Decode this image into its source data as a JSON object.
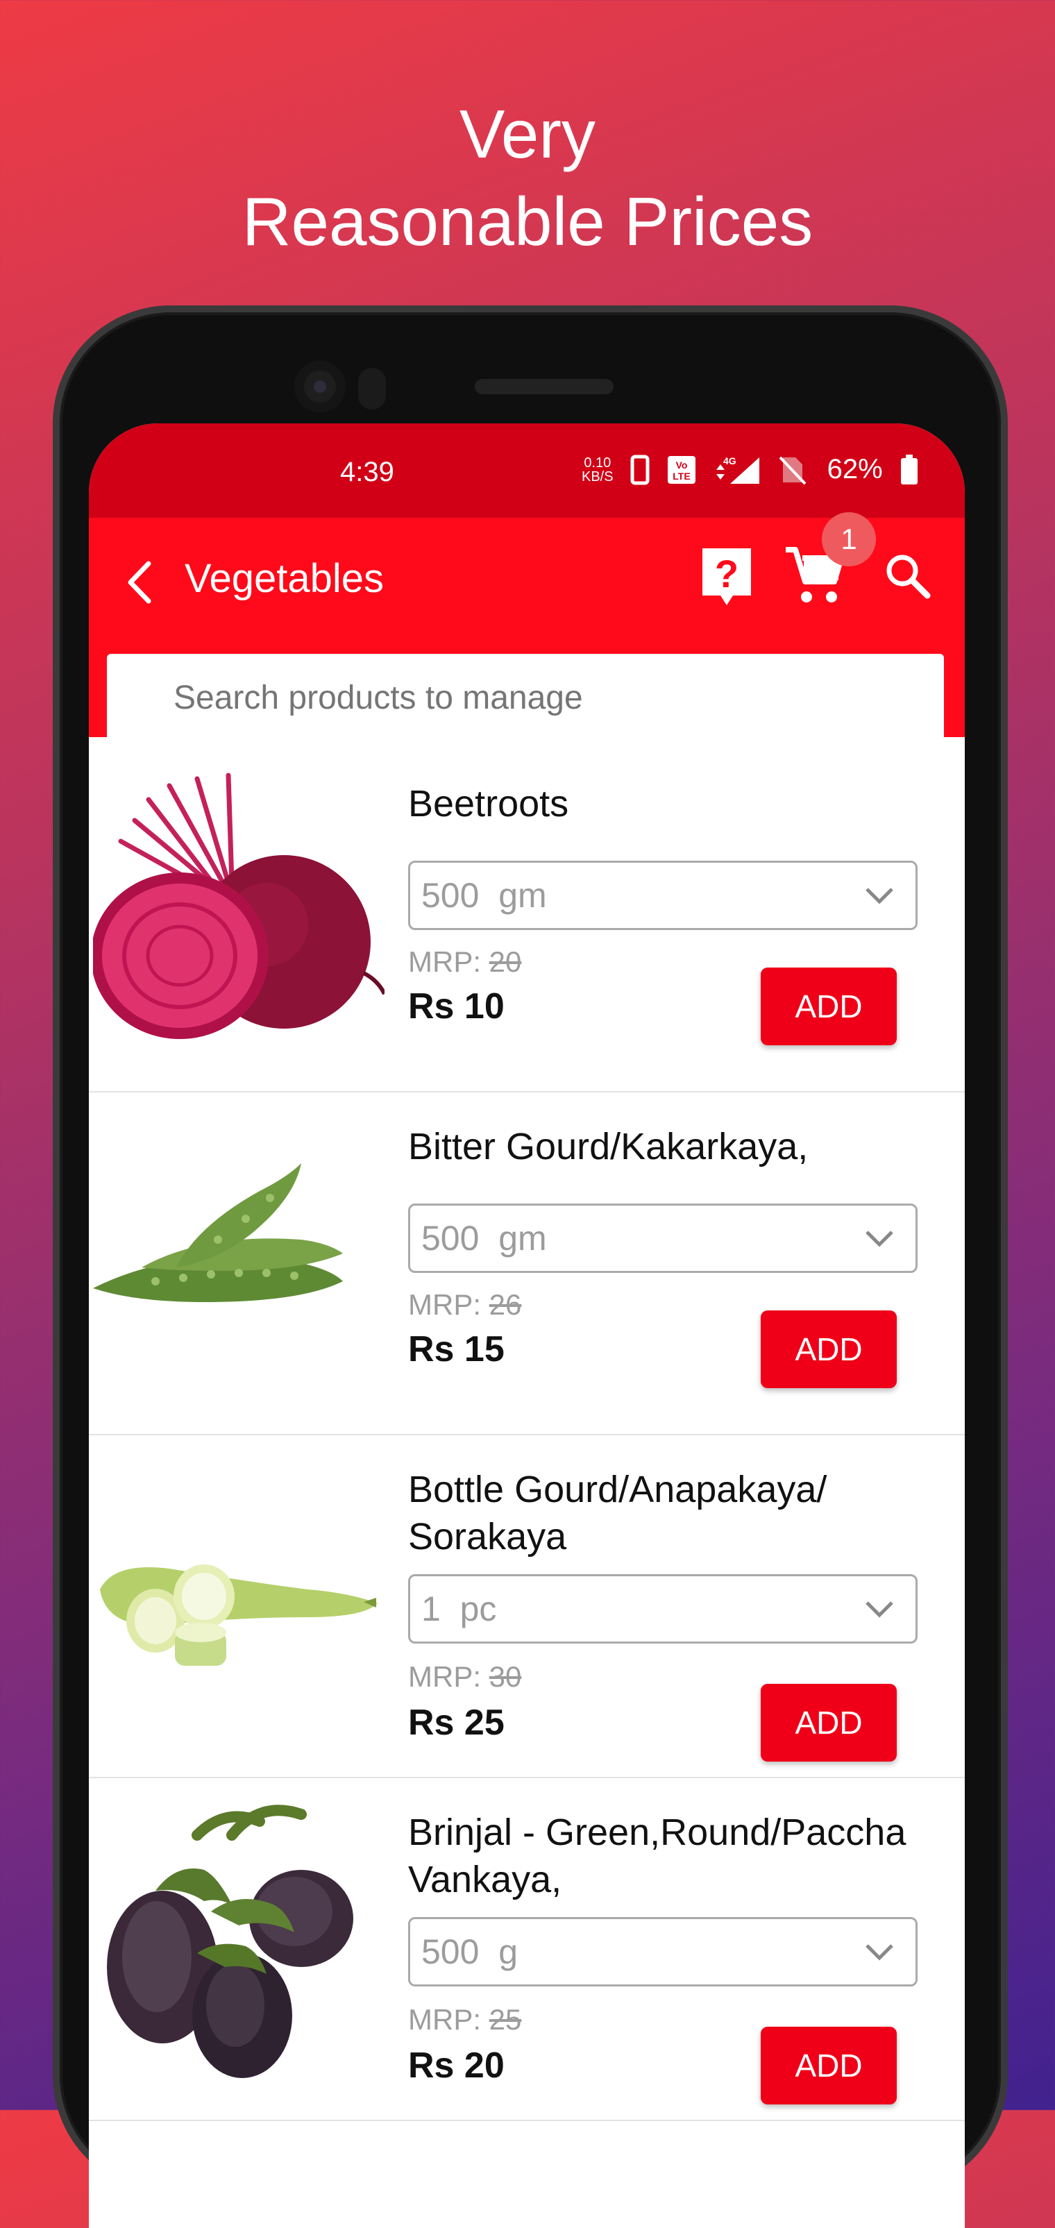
{
  "promo": {
    "line1": "Very",
    "line2": "Reasonable Prices"
  },
  "status_bar": {
    "time": "4:39",
    "speed_value": "0.10",
    "speed_unit": "KB/S",
    "battery": "62%"
  },
  "app_bar": {
    "title": "Vegetables",
    "cart_count": "1"
  },
  "search": {
    "placeholder": "Search products to manage"
  },
  "products": [
    {
      "name": "Beetroots",
      "qty_value": "500",
      "qty_unit": "gm",
      "mrp_label": "MRP:",
      "mrp_value": "20",
      "price": "Rs 10",
      "add_label": "ADD",
      "image": "beetroot"
    },
    {
      "name": "Bitter Gourd/Kakarkaya,",
      "qty_value": "500",
      "qty_unit": "gm",
      "mrp_label": "MRP:",
      "mrp_value": "26",
      "price": "Rs 15",
      "add_label": "ADD",
      "image": "bitter-gourd"
    },
    {
      "name": "Bottle Gourd/Anapakaya/ Sorakaya",
      "qty_value": "1",
      "qty_unit": "pc",
      "mrp_label": "MRP:",
      "mrp_value": "30",
      "price": "Rs 25",
      "add_label": "ADD",
      "image": "bottle-gourd"
    },
    {
      "name": "Brinjal - Green,Round/Paccha Vankaya,",
      "qty_value": "500",
      "qty_unit": "g",
      "mrp_label": "MRP:",
      "mrp_value": "25",
      "price": "Rs 20",
      "add_label": "ADD",
      "image": "brinjal"
    }
  ],
  "colors": {
    "appbar": "#ff0a1a",
    "statusbar": "#d10016",
    "add_button": "#f00018"
  }
}
